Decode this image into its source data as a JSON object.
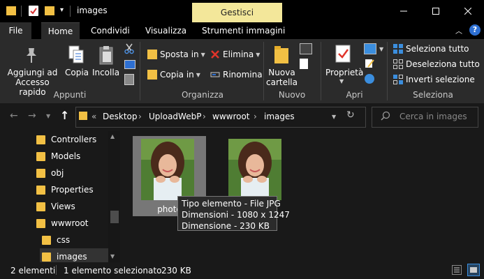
{
  "window": {
    "title": "images",
    "context_tab": "Gestisci"
  },
  "tabs": [
    "File",
    "Home",
    "Condividi",
    "Visualizza",
    "Strumenti immagini"
  ],
  "ribbon": {
    "appunti": {
      "pin_label": "Aggiungi ad Accesso rapido",
      "copy_label": "Copia",
      "paste_label": "Incolla",
      "group_label": "Appunti"
    },
    "organizza": {
      "move_label": "Sposta in",
      "copyto_label": "Copia in",
      "delete_label": "Elimina",
      "rename_label": "Rinomina",
      "group_label": "Organizza"
    },
    "nuovo": {
      "newfolder_label": "Nuova cartella",
      "group_label": "Nuovo"
    },
    "apri": {
      "properties_label": "Proprietà",
      "group_label": "Apri"
    },
    "seleziona": {
      "selectall_label": "Seleziona tutto",
      "deselectall_label": "Deseleziona tutto",
      "invert_label": "Inverti selezione",
      "group_label": "Seleziona"
    }
  },
  "address": {
    "crumbs": [
      "Desktop",
      "UploadWebP",
      "wwwroot",
      "images"
    ],
    "overflow": "«",
    "search_placeholder": "Cerca in images"
  },
  "nav": {
    "items": [
      "Controllers",
      "Models",
      "obj",
      "Properties",
      "Views",
      "wwwroot",
      "css",
      "images"
    ]
  },
  "files": [
    {
      "name": "photo",
      "selected": true
    },
    {
      "name": "",
      "selected": false
    }
  ],
  "tooltip": {
    "type": "Tipo elemento - File JPG",
    "dims": "Dimensioni - 1080 x 1247",
    "size": "Dimensione - 230 KB"
  },
  "status": {
    "count": "2 elementi",
    "selected": "1 elemento selezionato",
    "size": "230 KB"
  },
  "colors": {
    "folder": "#f2c044",
    "context_tab": "#f3e79a",
    "background": "#191919",
    "ribbon": "#2b2b2b"
  }
}
